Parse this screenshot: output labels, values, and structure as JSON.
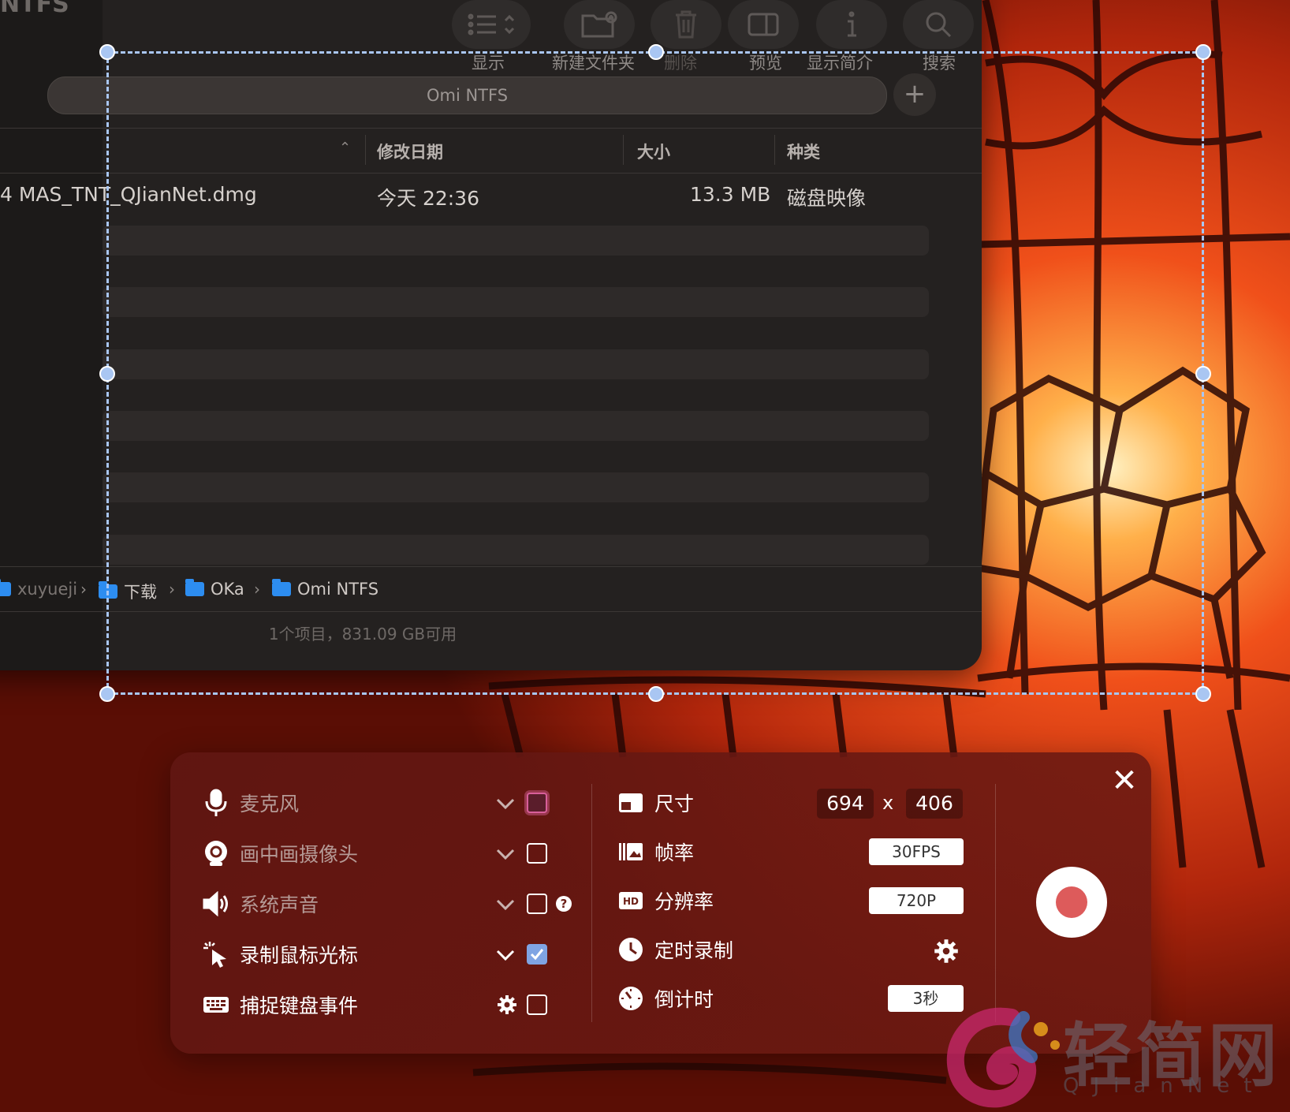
{
  "finder": {
    "title": "NTFS",
    "toolbar": {
      "view_label": "显示",
      "new_folder_label": "新建文件夹",
      "delete_label": "删除",
      "preview_label": "预览",
      "info_label": "显示简介",
      "search_label": "搜索"
    },
    "path_field": "Omi NTFS",
    "columns": {
      "date": "修改日期",
      "size": "大小",
      "kind": "种类"
    },
    "file": {
      "name": "4 MAS_TNT_QJianNet.dmg",
      "date": "今天 22:36",
      "size": "13.3 MB",
      "kind": "磁盘映像"
    },
    "breadcrumb": [
      "xuyueji",
      "下载",
      "OKa",
      "Omi NTFS"
    ],
    "status": "1个项目，831.09 GB可用"
  },
  "recorder": {
    "options": [
      {
        "label": "麦克风",
        "icon": "microphone-icon",
        "checked": false,
        "active": false
      },
      {
        "label": "画中画摄像头",
        "icon": "webcam-icon",
        "checked": false,
        "active": false
      },
      {
        "label": "系统声音",
        "icon": "speaker-icon",
        "checked": false,
        "active": false
      },
      {
        "label": "录制鼠标光标",
        "icon": "cursor-icon",
        "checked": true,
        "active": true
      },
      {
        "label": "捕捉键盘事件",
        "icon": "keyboard-icon",
        "checked": false,
        "active": true
      }
    ],
    "size_label": "尺寸",
    "width": "694",
    "x_sep": "x",
    "height": "406",
    "fps_label": "帧率",
    "fps_value": "30FPS",
    "resolution_label": "分辨率",
    "resolution_value": "720P",
    "timer_label": "定时录制",
    "countdown_label": "倒计时",
    "countdown_value": "3秒"
  },
  "watermark": {
    "main": "轻简网",
    "sub": "QJianNet"
  },
  "colors": {
    "accent_blue": "#a9c6f2",
    "record_red": "#dd5b5b",
    "checkbox_blue": "#7fa4e3"
  }
}
